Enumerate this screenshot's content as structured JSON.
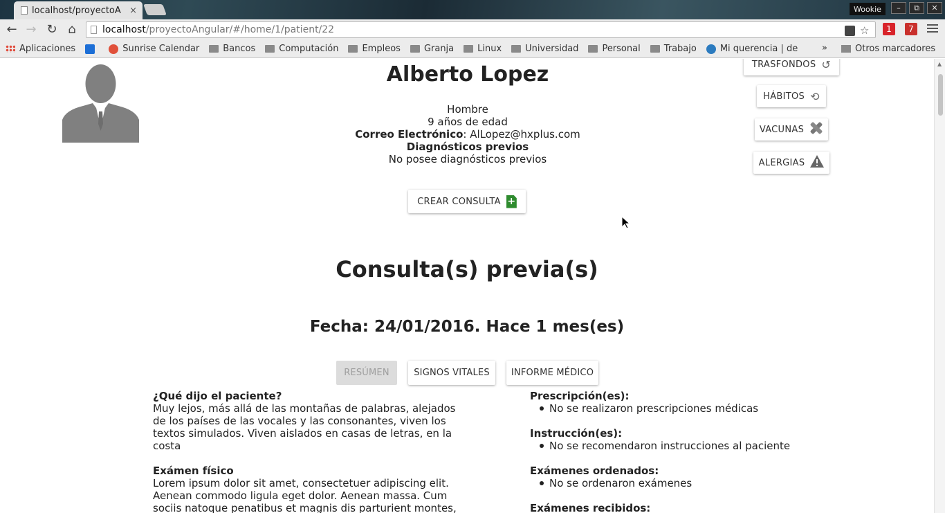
{
  "browser": {
    "tab_title": "localhost/proyectoA",
    "tab_close": "×",
    "profile_name": "Wookie",
    "url_host": "localhost",
    "url_path": "/proyectoAngular/#/home/1/patient/22",
    "window_controls": {
      "minimize": "–",
      "restore": "⧉",
      "close": "✕"
    },
    "nav": {
      "back": "←",
      "forward": "→",
      "reload": "↻",
      "home": "⌂"
    },
    "ext_badges": [
      "1",
      "7"
    ]
  },
  "bookmarks": {
    "items": [
      {
        "label": "Aplicaciones",
        "icon": "apps-icon"
      },
      {
        "label": "",
        "icon": "twitter-icon"
      },
      {
        "label": "Sunrise Calendar",
        "icon": "sunrise-icon"
      },
      {
        "label": "Bancos",
        "icon": "folder-icon"
      },
      {
        "label": "Computación",
        "icon": "folder-icon"
      },
      {
        "label": "Empleos",
        "icon": "folder-icon"
      },
      {
        "label": "Granja",
        "icon": "folder-icon"
      },
      {
        "label": "Linux",
        "icon": "folder-icon"
      },
      {
        "label": "Universidad",
        "icon": "folder-icon"
      },
      {
        "label": "Personal",
        "icon": "folder-icon"
      },
      {
        "label": "Trabajo",
        "icon": "folder-icon"
      },
      {
        "label": "Mi querencia | de",
        "icon": "wordpress-icon"
      }
    ],
    "overflow": "»",
    "other": "Otros marcadores"
  },
  "patient": {
    "name": "Alberto Lopez",
    "gender": "Hombre",
    "age": "9 años de edad",
    "email_label": "Correo Electrónico",
    "email_sep": ": ",
    "email": "AlLopez@hxplus.com",
    "diagnoses_label": "Diagnósticos previos",
    "diagnoses_value": "No posee diagnósticos previos"
  },
  "side_buttons": {
    "trasfondos": "TRASFONDOS",
    "habitos": "HÁBITOS",
    "vacunas": "VACUNAS",
    "alergias": "ALERGIAS"
  },
  "create_button": {
    "label": "CREAR CONSULTA",
    "icon": "+"
  },
  "consultas": {
    "title": "Consulta(s) previa(s)",
    "fecha": "Fecha: 24/01/2016. Hace 1 mes(es)",
    "tabs": {
      "resumen": "RESÚMEN",
      "signos": "SIGNOS VITALES",
      "informe": "INFORME MÉDICO"
    },
    "left": {
      "q1_title": "¿Qué dijo el paciente?",
      "q1_text": "Muy lejos, más allá de las montañas de palabras, alejados de los países de las vocales y las consonantes, viven los textos simulados. Viven aislados en casas de letras, en la costa",
      "q2_title": "Exámen físico",
      "q2_text": "Lorem ipsum dolor sit amet, consectetuer adipiscing elit. Aenean commodo ligula eget dolor. Aenean massa. Cum sociis natoque penatibus et magnis dis parturient montes, nascetur rid"
    },
    "right": {
      "prescripciones_title": "Prescripción(es):",
      "prescripciones_item": "No se realizaron prescripciones médicas",
      "instrucciones_title": "Instrucción(es):",
      "instrucciones_item": "No se recomendaron instrucciones al paciente",
      "ordenados_title": "Exámenes ordenados:",
      "ordenados_item": "No se ordenaron exámenes",
      "recibidos_title": "Exámenes recibidos:"
    }
  }
}
